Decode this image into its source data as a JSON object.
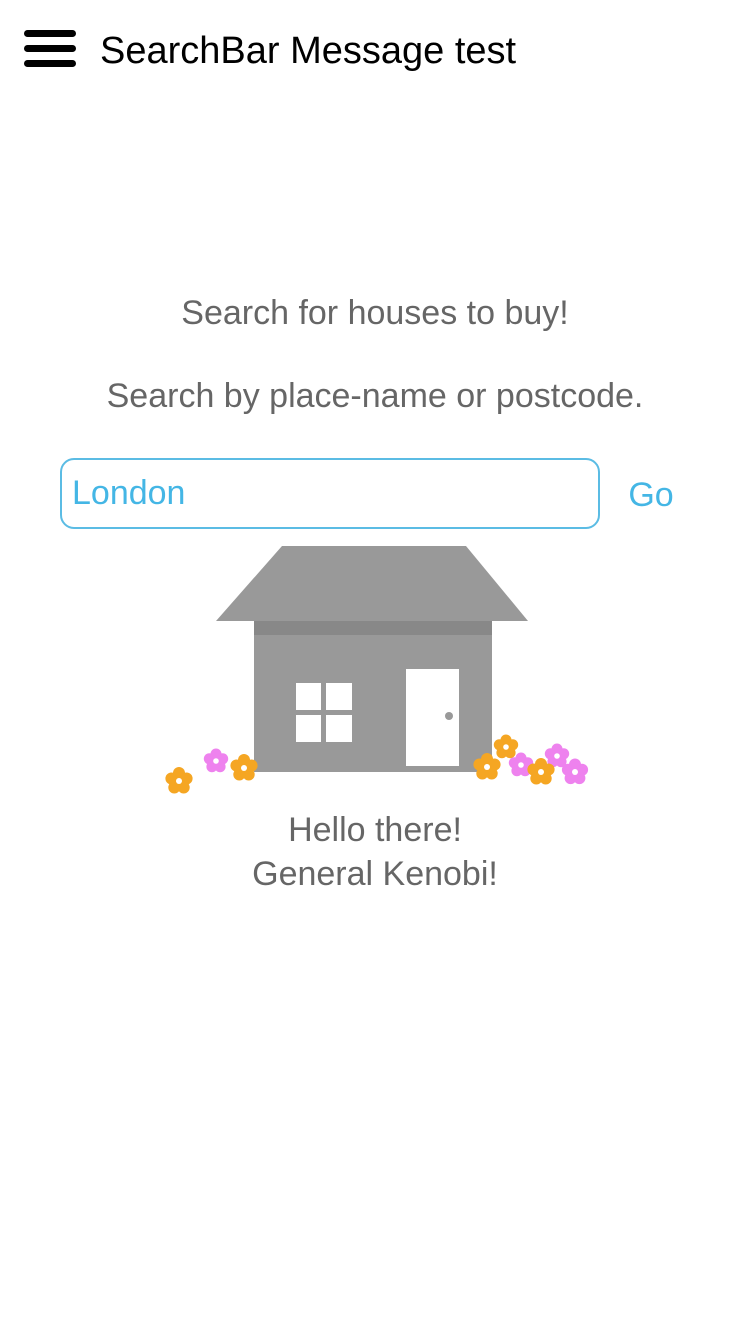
{
  "header": {
    "title": "SearchBar Message test",
    "menu_icon": "hamburger-menu-icon"
  },
  "main": {
    "prompt_line1": "Search for houses to buy!",
    "prompt_line2": "Search by place-name or postcode.",
    "search": {
      "value": "London",
      "placeholder": ""
    },
    "go_label": "Go",
    "illustration": "house-with-flowers",
    "greeting_line1": "Hello there!",
    "greeting_line2": "General Kenobi!"
  },
  "colors": {
    "accent": "#44b6e5",
    "text_gray": "#666666",
    "house_gray": "#999999",
    "flower_orange": "#f5a623",
    "flower_pink": "#ee82ee"
  }
}
